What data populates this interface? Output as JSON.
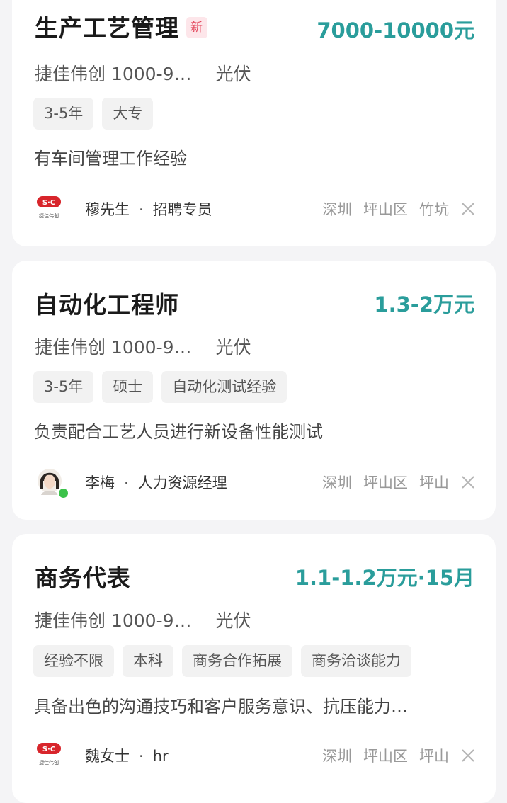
{
  "jobs": [
    {
      "title": "生产工艺管理",
      "badge": "新",
      "salary": "7000-10000元",
      "company": "捷佳伟创",
      "size": "1000-9…",
      "industry": "光伏",
      "tags": [
        "3-5年",
        "大专"
      ],
      "description": "有车间管理工作经验",
      "recruiter_name": "穆先生",
      "recruiter_title": "招聘专员",
      "location": [
        "深圳",
        "坪山区",
        "竹坑"
      ],
      "avatar": "company-logo",
      "logo_text": "捷佳伟创"
    },
    {
      "title": "自动化工程师",
      "salary": "1.3-2万元",
      "company": "捷佳伟创",
      "size": "1000-9…",
      "industry": "光伏",
      "tags": [
        "3-5年",
        "硕士",
        "自动化测试经验"
      ],
      "description": "负责配合工艺人员进行新设备性能测试",
      "recruiter_name": "李梅",
      "recruiter_title": "人力资源经理",
      "location": [
        "深圳",
        "坪山区",
        "坪山"
      ],
      "avatar": "person-photo",
      "online": true
    },
    {
      "title": "商务代表",
      "salary": "1.1-1.2万元·15月",
      "company": "捷佳伟创",
      "size": "1000-9…",
      "industry": "光伏",
      "tags": [
        "经验不限",
        "本科",
        "商务合作拓展",
        "商务洽谈能力"
      ],
      "description": "具备出色的沟通技巧和客户服务意识、抗压能力…",
      "recruiter_name": "魏女士",
      "recruiter_title": "hr",
      "location": [
        "深圳",
        "坪山区",
        "坪山"
      ],
      "avatar": "company-logo",
      "logo_text": "捷佳伟创"
    }
  ],
  "colors": {
    "salary": "#2a9d9b",
    "badge": "#e2455a",
    "online": "#3cc24a"
  }
}
